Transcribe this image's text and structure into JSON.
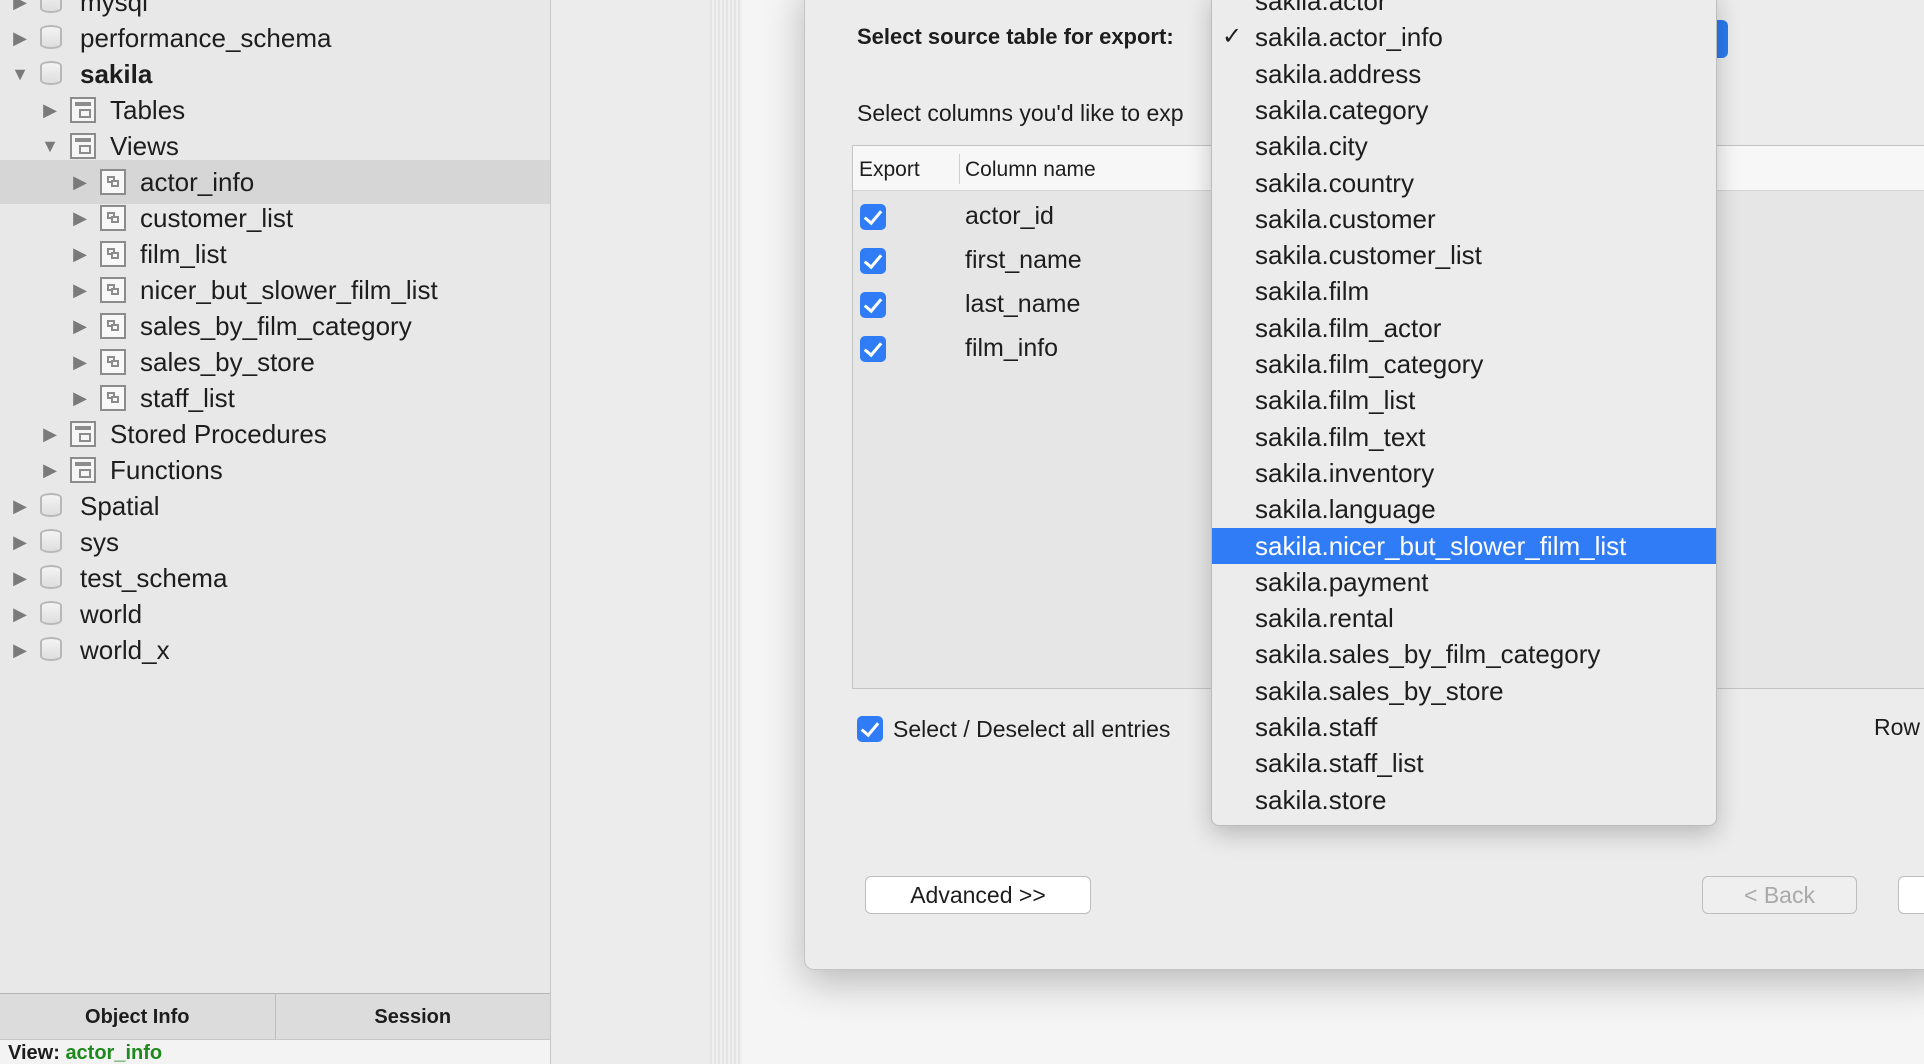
{
  "sidebar": {
    "tree": [
      {
        "label": "mysql",
        "icon": "database-icon",
        "level": 0,
        "expanded": false
      },
      {
        "label": "performance_schema",
        "icon": "database-icon",
        "level": 0,
        "expanded": false
      },
      {
        "label": "sakila",
        "icon": "database-icon",
        "level": 0,
        "expanded": true,
        "bold": true
      },
      {
        "label": "Tables",
        "icon": "tables-folder-icon",
        "level": 1,
        "expanded": false
      },
      {
        "label": "Views",
        "icon": "views-folder-icon",
        "level": 1,
        "expanded": true
      },
      {
        "label": "actor_info",
        "icon": "view-icon",
        "level": 2,
        "expanded": false,
        "selected": true
      },
      {
        "label": "customer_list",
        "icon": "view-icon",
        "level": 2,
        "expanded": false
      },
      {
        "label": "film_list",
        "icon": "view-icon",
        "level": 2,
        "expanded": false
      },
      {
        "label": "nicer_but_slower_film_list",
        "icon": "view-icon",
        "level": 2,
        "expanded": false
      },
      {
        "label": "sales_by_film_category",
        "icon": "view-icon",
        "level": 2,
        "expanded": false
      },
      {
        "label": "sales_by_store",
        "icon": "view-icon",
        "level": 2,
        "expanded": false
      },
      {
        "label": "staff_list",
        "icon": "view-icon",
        "level": 2,
        "expanded": false
      },
      {
        "label": "Stored Procedures",
        "icon": "procedures-folder-icon",
        "level": 1,
        "expanded": false
      },
      {
        "label": "Functions",
        "icon": "functions-folder-icon",
        "level": 1,
        "expanded": false
      },
      {
        "label": "Spatial",
        "icon": "database-icon",
        "level": 0,
        "expanded": false
      },
      {
        "label": "sys",
        "icon": "database-icon",
        "level": 0,
        "expanded": false
      },
      {
        "label": "test_schema",
        "icon": "database-icon",
        "level": 0,
        "expanded": false
      },
      {
        "label": "world",
        "icon": "database-icon",
        "level": 0,
        "expanded": false
      },
      {
        "label": "world_x",
        "icon": "database-icon",
        "level": 0,
        "expanded": false
      }
    ],
    "tabs": {
      "object_info": "Object Info",
      "session": "Session"
    },
    "info": {
      "prefix": "View:",
      "value": "actor_info"
    }
  },
  "wizard": {
    "source_label": "Select source table for export:",
    "columns_label": "Select columns you'd like to exp",
    "table": {
      "headers": {
        "export": "Export",
        "column_name": "Column name"
      },
      "rows": [
        {
          "checked": true,
          "name": "actor_id"
        },
        {
          "checked": true,
          "name": "first_name"
        },
        {
          "checked": true,
          "name": "last_name"
        },
        {
          "checked": true,
          "name": "film_info"
        }
      ]
    },
    "select_all_label": "Select / Deselect all entries",
    "row_label": "Row",
    "buttons": {
      "advanced": "Advanced >>",
      "back": "< Back"
    }
  },
  "dropdown": {
    "checked_item": "sakila.actor_info",
    "highlighted_item": "sakila.nicer_but_slower_film_list",
    "items": [
      "sakila.actor",
      "sakila.actor_info",
      "sakila.address",
      "sakila.category",
      "sakila.city",
      "sakila.country",
      "sakila.customer",
      "sakila.customer_list",
      "sakila.film",
      "sakila.film_actor",
      "sakila.film_category",
      "sakila.film_list",
      "sakila.film_text",
      "sakila.inventory",
      "sakila.language",
      "sakila.nicer_but_slower_film_list",
      "sakila.payment",
      "sakila.rental",
      "sakila.sales_by_film_category",
      "sakila.sales_by_store",
      "sakila.staff",
      "sakila.staff_list",
      "sakila.store"
    ]
  },
  "colors": {
    "accent": "#2f7cf6",
    "info_value": "#1e8a1e"
  }
}
